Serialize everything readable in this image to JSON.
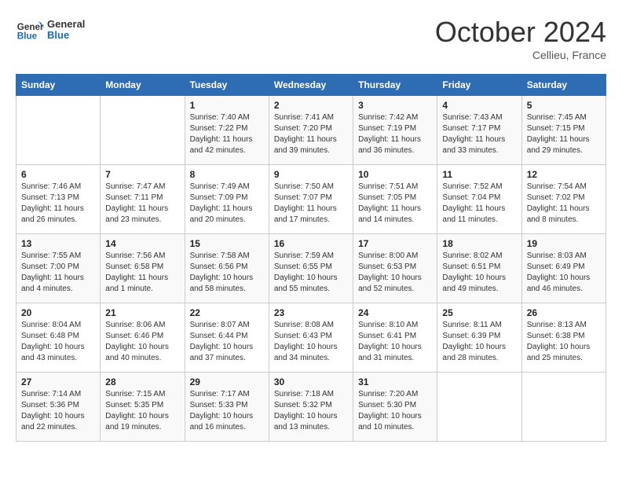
{
  "header": {
    "logo_line1": "General",
    "logo_line2": "Blue",
    "month": "October 2024",
    "location": "Cellieu, France"
  },
  "weekdays": [
    "Sunday",
    "Monday",
    "Tuesday",
    "Wednesday",
    "Thursday",
    "Friday",
    "Saturday"
  ],
  "weeks": [
    [
      {
        "day": null,
        "sunrise": null,
        "sunset": null,
        "daylight": null
      },
      {
        "day": null,
        "sunrise": null,
        "sunset": null,
        "daylight": null
      },
      {
        "day": "1",
        "sunrise": "Sunrise: 7:40 AM",
        "sunset": "Sunset: 7:22 PM",
        "daylight": "Daylight: 11 hours and 42 minutes."
      },
      {
        "day": "2",
        "sunrise": "Sunrise: 7:41 AM",
        "sunset": "Sunset: 7:20 PM",
        "daylight": "Daylight: 11 hours and 39 minutes."
      },
      {
        "day": "3",
        "sunrise": "Sunrise: 7:42 AM",
        "sunset": "Sunset: 7:19 PM",
        "daylight": "Daylight: 11 hours and 36 minutes."
      },
      {
        "day": "4",
        "sunrise": "Sunrise: 7:43 AM",
        "sunset": "Sunset: 7:17 PM",
        "daylight": "Daylight: 11 hours and 33 minutes."
      },
      {
        "day": "5",
        "sunrise": "Sunrise: 7:45 AM",
        "sunset": "Sunset: 7:15 PM",
        "daylight": "Daylight: 11 hours and 29 minutes."
      }
    ],
    [
      {
        "day": "6",
        "sunrise": "Sunrise: 7:46 AM",
        "sunset": "Sunset: 7:13 PM",
        "daylight": "Daylight: 11 hours and 26 minutes."
      },
      {
        "day": "7",
        "sunrise": "Sunrise: 7:47 AM",
        "sunset": "Sunset: 7:11 PM",
        "daylight": "Daylight: 11 hours and 23 minutes."
      },
      {
        "day": "8",
        "sunrise": "Sunrise: 7:49 AM",
        "sunset": "Sunset: 7:09 PM",
        "daylight": "Daylight: 11 hours and 20 minutes."
      },
      {
        "day": "9",
        "sunrise": "Sunrise: 7:50 AM",
        "sunset": "Sunset: 7:07 PM",
        "daylight": "Daylight: 11 hours and 17 minutes."
      },
      {
        "day": "10",
        "sunrise": "Sunrise: 7:51 AM",
        "sunset": "Sunset: 7:05 PM",
        "daylight": "Daylight: 11 hours and 14 minutes."
      },
      {
        "day": "11",
        "sunrise": "Sunrise: 7:52 AM",
        "sunset": "Sunset: 7:04 PM",
        "daylight": "Daylight: 11 hours and 11 minutes."
      },
      {
        "day": "12",
        "sunrise": "Sunrise: 7:54 AM",
        "sunset": "Sunset: 7:02 PM",
        "daylight": "Daylight: 11 hours and 8 minutes."
      }
    ],
    [
      {
        "day": "13",
        "sunrise": "Sunrise: 7:55 AM",
        "sunset": "Sunset: 7:00 PM",
        "daylight": "Daylight: 11 hours and 4 minutes."
      },
      {
        "day": "14",
        "sunrise": "Sunrise: 7:56 AM",
        "sunset": "Sunset: 6:58 PM",
        "daylight": "Daylight: 11 hours and 1 minute."
      },
      {
        "day": "15",
        "sunrise": "Sunrise: 7:58 AM",
        "sunset": "Sunset: 6:56 PM",
        "daylight": "Daylight: 10 hours and 58 minutes."
      },
      {
        "day": "16",
        "sunrise": "Sunrise: 7:59 AM",
        "sunset": "Sunset: 6:55 PM",
        "daylight": "Daylight: 10 hours and 55 minutes."
      },
      {
        "day": "17",
        "sunrise": "Sunrise: 8:00 AM",
        "sunset": "Sunset: 6:53 PM",
        "daylight": "Daylight: 10 hours and 52 minutes."
      },
      {
        "day": "18",
        "sunrise": "Sunrise: 8:02 AM",
        "sunset": "Sunset: 6:51 PM",
        "daylight": "Daylight: 10 hours and 49 minutes."
      },
      {
        "day": "19",
        "sunrise": "Sunrise: 8:03 AM",
        "sunset": "Sunset: 6:49 PM",
        "daylight": "Daylight: 10 hours and 46 minutes."
      }
    ],
    [
      {
        "day": "20",
        "sunrise": "Sunrise: 8:04 AM",
        "sunset": "Sunset: 6:48 PM",
        "daylight": "Daylight: 10 hours and 43 minutes."
      },
      {
        "day": "21",
        "sunrise": "Sunrise: 8:06 AM",
        "sunset": "Sunset: 6:46 PM",
        "daylight": "Daylight: 10 hours and 40 minutes."
      },
      {
        "day": "22",
        "sunrise": "Sunrise: 8:07 AM",
        "sunset": "Sunset: 6:44 PM",
        "daylight": "Daylight: 10 hours and 37 minutes."
      },
      {
        "day": "23",
        "sunrise": "Sunrise: 8:08 AM",
        "sunset": "Sunset: 6:43 PM",
        "daylight": "Daylight: 10 hours and 34 minutes."
      },
      {
        "day": "24",
        "sunrise": "Sunrise: 8:10 AM",
        "sunset": "Sunset: 6:41 PM",
        "daylight": "Daylight: 10 hours and 31 minutes."
      },
      {
        "day": "25",
        "sunrise": "Sunrise: 8:11 AM",
        "sunset": "Sunset: 6:39 PM",
        "daylight": "Daylight: 10 hours and 28 minutes."
      },
      {
        "day": "26",
        "sunrise": "Sunrise: 8:13 AM",
        "sunset": "Sunset: 6:38 PM",
        "daylight": "Daylight: 10 hours and 25 minutes."
      }
    ],
    [
      {
        "day": "27",
        "sunrise": "Sunrise: 7:14 AM",
        "sunset": "Sunset: 5:36 PM",
        "daylight": "Daylight: 10 hours and 22 minutes."
      },
      {
        "day": "28",
        "sunrise": "Sunrise: 7:15 AM",
        "sunset": "Sunset: 5:35 PM",
        "daylight": "Daylight: 10 hours and 19 minutes."
      },
      {
        "day": "29",
        "sunrise": "Sunrise: 7:17 AM",
        "sunset": "Sunset: 5:33 PM",
        "daylight": "Daylight: 10 hours and 16 minutes."
      },
      {
        "day": "30",
        "sunrise": "Sunrise: 7:18 AM",
        "sunset": "Sunset: 5:32 PM",
        "daylight": "Daylight: 10 hours and 13 minutes."
      },
      {
        "day": "31",
        "sunrise": "Sunrise: 7:20 AM",
        "sunset": "Sunset: 5:30 PM",
        "daylight": "Daylight: 10 hours and 10 minutes."
      },
      {
        "day": null,
        "sunrise": null,
        "sunset": null,
        "daylight": null
      },
      {
        "day": null,
        "sunrise": null,
        "sunset": null,
        "daylight": null
      }
    ]
  ]
}
